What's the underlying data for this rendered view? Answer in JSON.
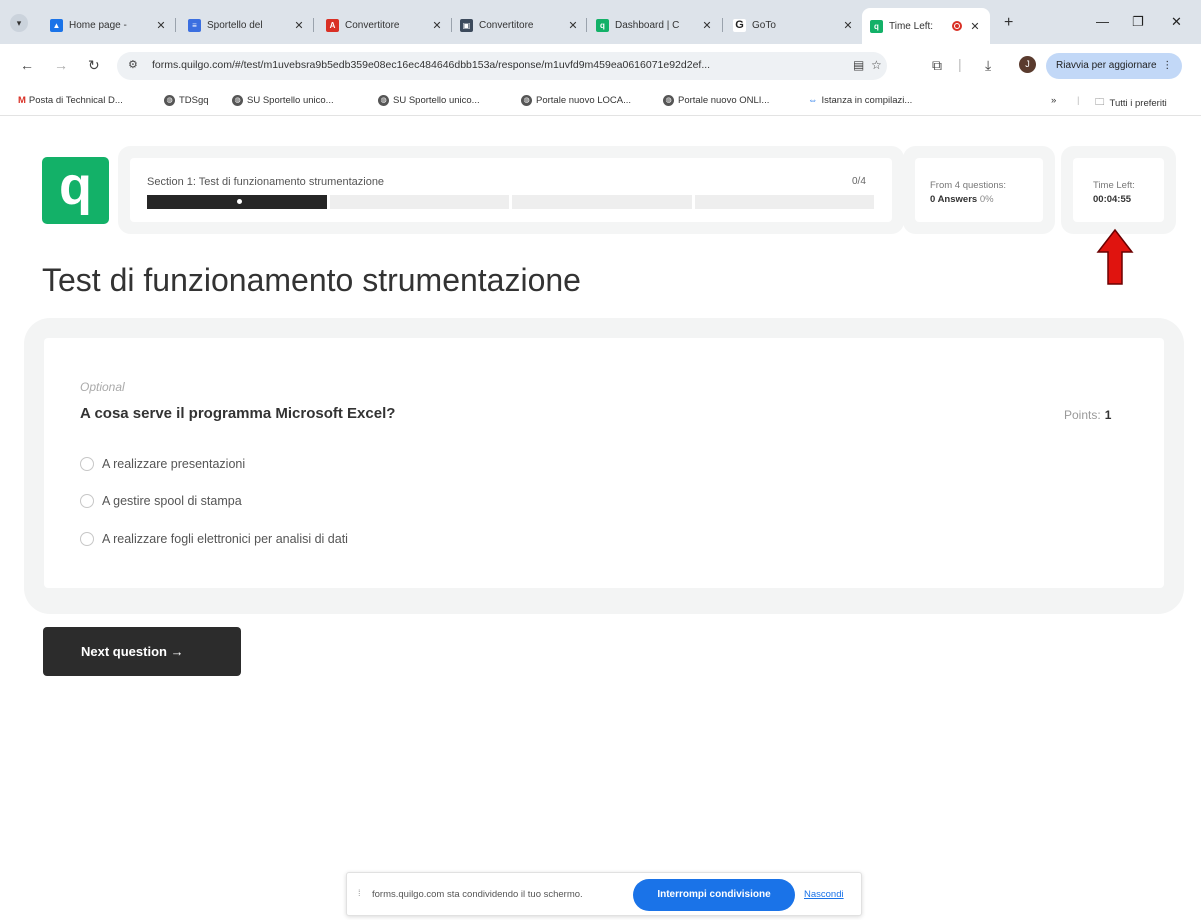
{
  "browser": {
    "tabs": [
      {
        "title": "Home page -",
        "icon": "google-drive-icon",
        "color": "#1a73e8"
      },
      {
        "title": "Sportello del",
        "icon": "google-forms-icon",
        "color": "#3b6fe0"
      },
      {
        "title": "Convertitore",
        "icon": "acrobat-icon",
        "color": "#d93025"
      },
      {
        "title": "Convertitore",
        "icon": "converter-icon",
        "color": "#3c4a5c"
      },
      {
        "title": "Dashboard | C",
        "icon": "quilgo-icon",
        "color": "#13b168"
      },
      {
        "title": "GoTo",
        "icon": "goto-icon",
        "color": "#222222"
      }
    ],
    "active_tab": {
      "title": "Time Left:",
      "icon": "quilgo-icon",
      "color": "#13b168"
    },
    "new_tab": "+",
    "url": "forms.quilgo.com/#/test/m1uvebsra9b5edb359e08ec16ec484646dbb153a/response/m1uvfd9m459ea0616071e92d2ef...",
    "profile_initial": "J",
    "update_button": "Riavvia per aggiornare",
    "bookmarks": [
      {
        "label": "Posta di Technical D...",
        "icon": "gmail-icon"
      },
      {
        "label": "TDSgq",
        "icon": "globe-icon"
      },
      {
        "label": "SU Sportello unico...",
        "icon": "globe-icon"
      },
      {
        "label": "SU Sportello unico...",
        "icon": "globe-icon"
      },
      {
        "label": "Portale nuovo LOCA...",
        "icon": "globe-icon"
      },
      {
        "label": "Portale nuovo ONLI...",
        "icon": "globe-icon"
      },
      {
        "label": "Istanza in compilazi...",
        "icon": "link-icon"
      }
    ],
    "bookmarks_more": "»",
    "all_bookmarks": "Tutti i preferiti"
  },
  "quiz": {
    "logo_letter": "q",
    "section_title": "Section 1: Test di funzionamento strumentazione",
    "section_count": "0/4",
    "progress_segments": 4,
    "progress_fraction": 0.25,
    "stats": {
      "questions_label": "From 4 questions:",
      "answers_value": "0 Answers",
      "answers_percent": "0%",
      "time_label": "Time Left:",
      "time_value": "00:04:55"
    },
    "page_title": "Test di funzionamento strumentazione",
    "question": {
      "optional_label": "Optional",
      "text": "A cosa serve il programma Microsoft Excel?",
      "points_label": "Points:",
      "points_value": "1",
      "answers": [
        "A realizzare presentazioni",
        "A gestire spool di stampa",
        "A realizzare fogli elettronici per analisi di dati"
      ]
    },
    "next_button": "Next question →"
  },
  "screen_share": {
    "message": "forms.quilgo.com sta condividendo il tuo schermo.",
    "stop_button": "Interrompi condivisione",
    "hide_link": "Nascondi"
  },
  "colors": {
    "brand_green": "#13b168",
    "dark_button": "#2c2c2c",
    "chrome_blue": "#1a73e8",
    "annotation_arrow": "#e0140f"
  }
}
